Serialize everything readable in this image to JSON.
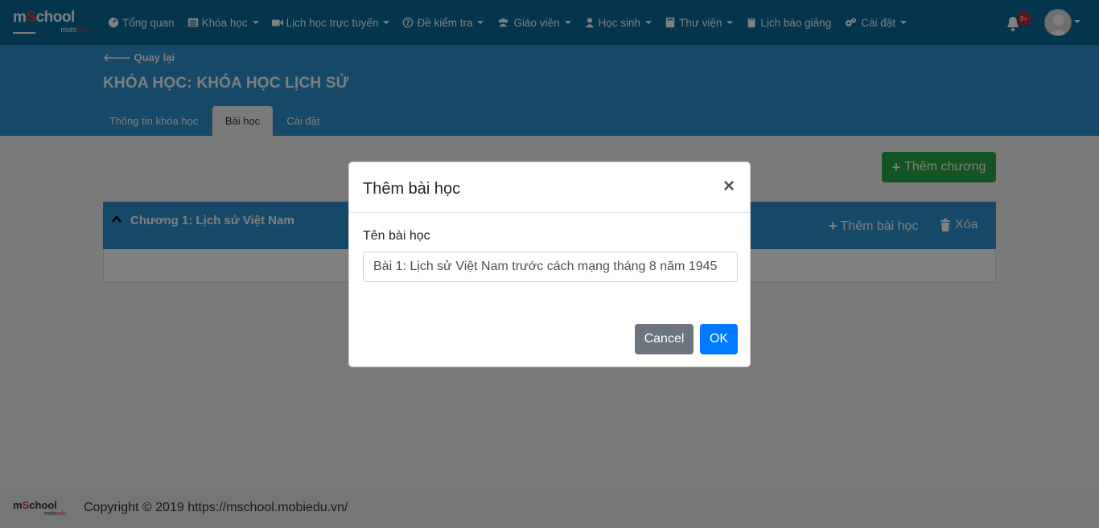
{
  "logo": {
    "main_prefix": "m",
    "main_s": "S",
    "main_suffix": "chool",
    "sub_prefix": "mobi",
    "sub_suffix": "edu"
  },
  "nav": {
    "items": [
      {
        "label": "Tổng quan",
        "icon": "dashboard-icon",
        "has_caret": false
      },
      {
        "label": "Khóa học",
        "icon": "list-icon",
        "has_caret": true
      },
      {
        "label": "Lịch học trực tuyến",
        "icon": "video-icon",
        "has_caret": true
      },
      {
        "label": "Đề kiểm tra",
        "icon": "question-circle-icon",
        "has_caret": true
      },
      {
        "label": "Giáo viên",
        "icon": "users-icon",
        "has_caret": true
      },
      {
        "label": "Học sinh",
        "icon": "user-icon",
        "has_caret": true
      },
      {
        "label": "Thư viện",
        "icon": "book-icon",
        "has_caret": true
      },
      {
        "label": "Lịch báo giảng",
        "icon": "clipboard-icon",
        "has_caret": false
      },
      {
        "label": "Cài đặt",
        "icon": "gears-icon",
        "has_caret": true
      }
    ],
    "notification_badge": "9+"
  },
  "header": {
    "back_label": "Quay lại",
    "title": "KHÓA HỌC: KHÓA HỌC LỊCH SỬ",
    "tabs": [
      {
        "label": "Thông tin khóa học",
        "active": false
      },
      {
        "label": "Bài học",
        "active": true
      },
      {
        "label": "Cài đặt",
        "active": false
      }
    ]
  },
  "content": {
    "add_chapter_label": "Thêm chương",
    "chapter": {
      "title": "Chương 1: Lịch sử Việt Nam",
      "add_lesson_label": "Thêm bài học",
      "delete_label": "Xóa"
    }
  },
  "footer": {
    "text": "Copyright © 2019 https://mschool.mobiedu.vn/"
  },
  "modal": {
    "title": "Thêm bài học",
    "close_symbol": "×",
    "field_label": "Tên bài học",
    "field_value": "Bài 1: Lịch sử Việt Nam trước cách mạng tháng 8 năm 1945",
    "cancel_label": "Cancel",
    "ok_label": "OK"
  },
  "colors": {
    "nav_bg": "#0b6a99",
    "band_bg": "#2d93cf",
    "success": "#28a745",
    "primary": "#007bff",
    "secondary": "#6c757d",
    "badge": "#c82333"
  }
}
